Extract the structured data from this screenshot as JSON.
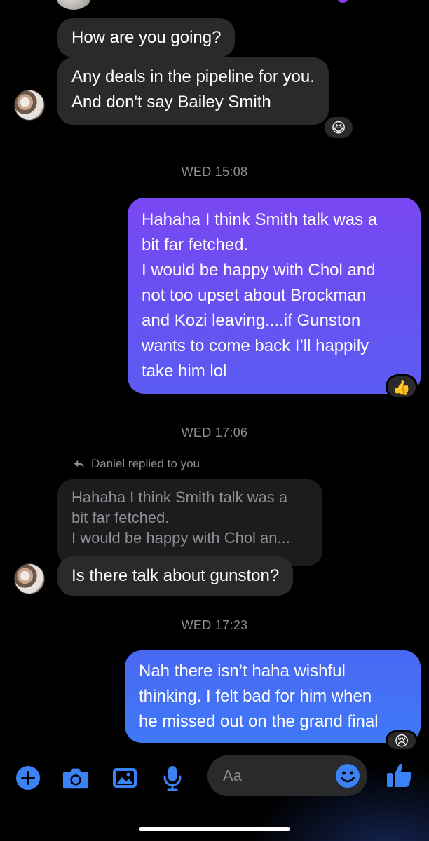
{
  "conversation": {
    "contact_name": "Daniel",
    "messages": [
      {
        "id": "m1",
        "direction": "in",
        "lines": [
          "How are you going?"
        ]
      },
      {
        "id": "m2",
        "direction": "in",
        "lines": [
          "Any deals in the pipeline for you.",
          "And don't say Bailey Smith"
        ],
        "reaction": "😆"
      },
      {
        "id": "t1",
        "type": "timestamp",
        "text": "WED 15:08"
      },
      {
        "id": "m3",
        "direction": "out",
        "lines": [
          "Hahaha I think Smith talk was a",
          "bit far fetched.",
          "I would be happy with Chol and",
          "not too upset about Brockman",
          "and Kozi leaving....if Gunston",
          "wants to come back I’ll happily",
          "take him lol"
        ],
        "reaction": "👍"
      },
      {
        "id": "t2",
        "type": "timestamp",
        "text": "WED 17:06"
      },
      {
        "id": "r1",
        "type": "reply_note",
        "text": "Daniel replied to you"
      },
      {
        "id": "q1",
        "type": "quoted",
        "lines": [
          "Hahaha I think Smith talk was a",
          "bit far fetched.",
          "I would be happy with Chol an..."
        ]
      },
      {
        "id": "m4",
        "direction": "in",
        "lines": [
          "Is there talk about gunston?"
        ]
      },
      {
        "id": "t3",
        "type": "timestamp",
        "text": "WED 17:23"
      },
      {
        "id": "m5",
        "direction": "out",
        "lines": [
          "Nah there isn’t haha wishful",
          "thinking. I felt bad for him when",
          "he missed out on the grand final"
        ],
        "reaction": "😢"
      }
    ]
  },
  "composer": {
    "placeholder": "Aa",
    "icons": [
      "plus-icon",
      "camera-icon",
      "image-icon",
      "microphone-icon",
      "emoji-icon",
      "thumbs-up-icon"
    ]
  },
  "colors": {
    "background": "#000000",
    "incoming_bubble": "#2a2a2c",
    "outgoing_gradient_top": "#7a48f2",
    "outgoing_gradient_bottom": "#3f78f6",
    "accent": "#3b82f6",
    "muted_text": "#8e8e93"
  }
}
